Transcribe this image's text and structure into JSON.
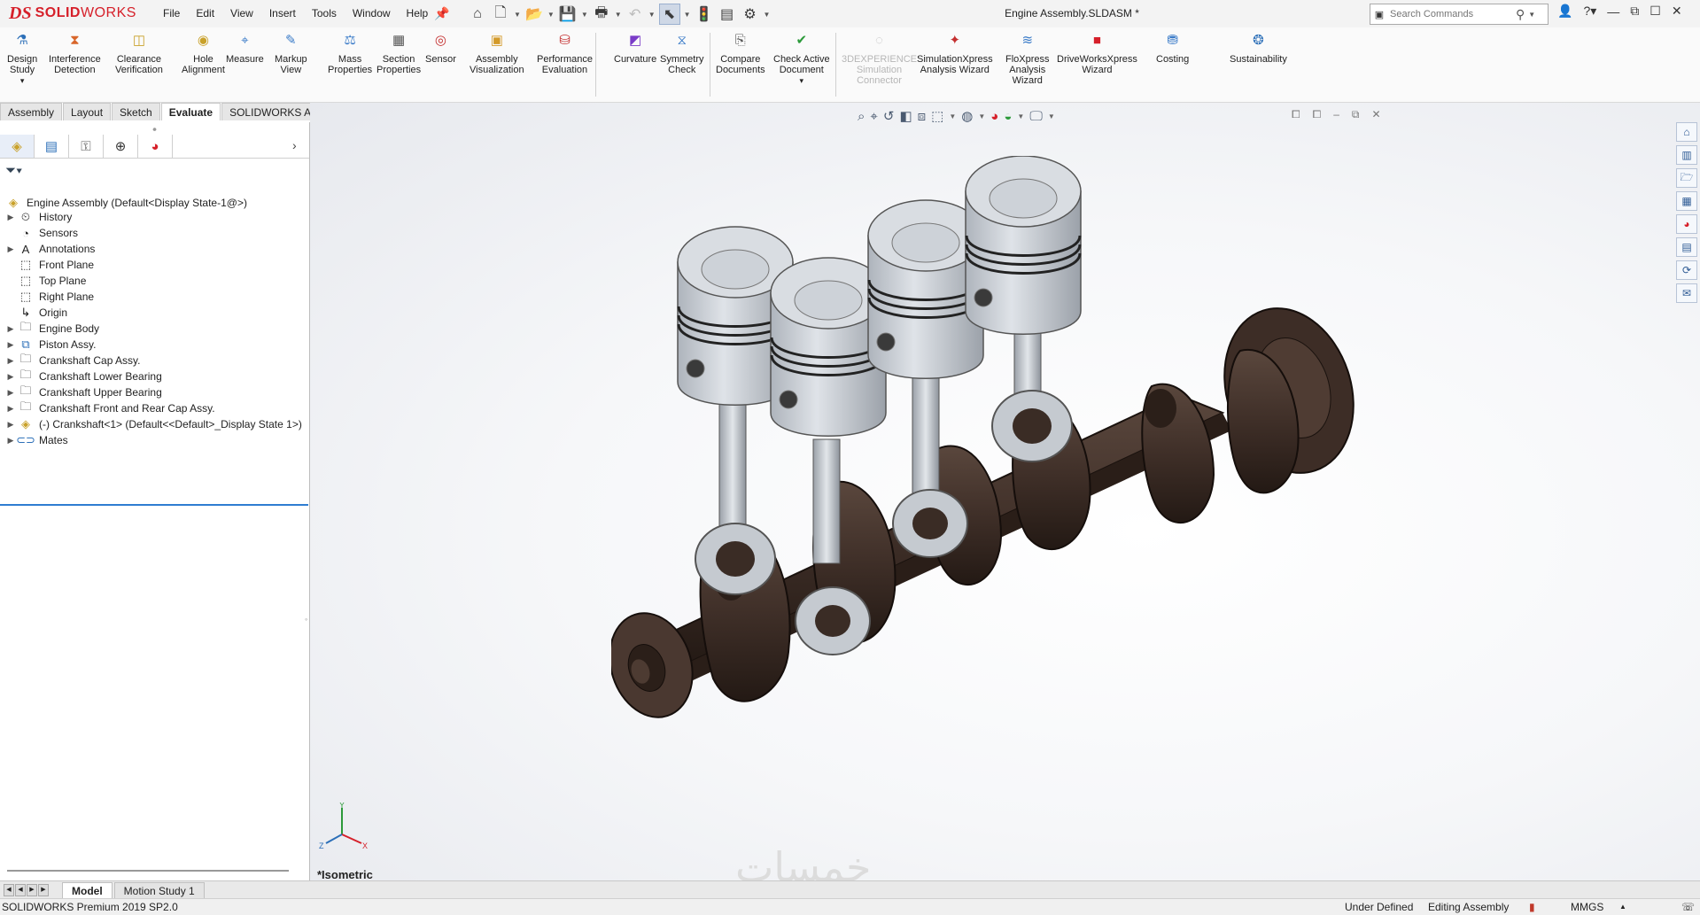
{
  "titlebar": {
    "brand_ds": "DS",
    "brand_name_bold": "SOLID",
    "brand_name_rest": "WORKS",
    "document_title": "Engine Assembly.SLDASM *",
    "menus": [
      "File",
      "Edit",
      "View",
      "Insert",
      "Tools",
      "Window",
      "Help"
    ],
    "search_placeholder": "Search Commands",
    "window_controls": [
      "user-icon",
      "help-icon",
      "minimize-icon",
      "restore-icon",
      "maximize-icon",
      "close-icon"
    ]
  },
  "quick_access": {
    "icons": [
      "home-icon",
      "new-document-icon",
      "open-icon",
      "save-icon",
      "print-icon",
      "undo-icon",
      "select-icon",
      "rebuild-icon",
      "file-properties-icon",
      "options-icon"
    ]
  },
  "commands": [
    {
      "label1": "Design",
      "label2": "Study",
      "icon": "design-study-icon",
      "color": "#2c6fb8"
    },
    {
      "label1": "Interference",
      "label2": "Detection",
      "icon": "interference-detection-icon",
      "color": "#d8662a"
    },
    {
      "label1": "Clearance",
      "label2": "Verification",
      "icon": "clearance-verification-icon",
      "color": "#c9a12a"
    },
    {
      "label1": "Hole",
      "label2": "Alignment",
      "icon": "hole-alignment-icon",
      "color": "#c9a12a"
    },
    {
      "label1": "Measure",
      "label2": "",
      "icon": "measure-icon",
      "color": "#3a7bc8"
    },
    {
      "label1": "Markup",
      "label2": "View",
      "icon": "markup-view-icon",
      "color": "#3a7bc8"
    },
    {
      "label1": "Mass",
      "label2": "Properties",
      "icon": "mass-properties-icon",
      "color": "#3a7bc8"
    },
    {
      "label1": "Section",
      "label2": "Properties",
      "icon": "section-properties-icon",
      "color": "#555555"
    },
    {
      "label1": "Sensor",
      "label2": "",
      "icon": "sensor-icon",
      "color": "#c43030"
    },
    {
      "label1": "Assembly",
      "label2": "Visualization",
      "icon": "assembly-visualization-icon",
      "color": "#d39a2a"
    },
    {
      "label1": "Performance",
      "label2": "Evaluation",
      "icon": "performance-evaluation-icon",
      "color": "#c43030"
    },
    {
      "label1": "Curvature",
      "label2": "",
      "icon": "curvature-icon",
      "color": "#7a3cc8"
    },
    {
      "label1": "Symmetry",
      "label2": "Check",
      "icon": "symmetry-check-icon",
      "color": "#3a7bc8"
    },
    {
      "label1": "Compare",
      "label2": "Documents",
      "icon": "compare-documents-icon",
      "color": "#555555"
    },
    {
      "label1": "Check Active",
      "label2": "Document",
      "icon": "check-active-document-icon",
      "color": "#2c9a3a"
    },
    {
      "label1": "3DEXPERIENCE",
      "label2": "Simulation",
      "label3": "Connector",
      "icon": "3dexperience-connector-icon",
      "color": "#bbbbbb",
      "disabled": true
    },
    {
      "label1": "SimulationXpress",
      "label2": "Analysis Wizard",
      "icon": "simulationxpress-icon",
      "color": "#c43030"
    },
    {
      "label1": "FloXpress",
      "label2": "Analysis",
      "label3": "Wizard",
      "icon": "floxpress-icon",
      "color": "#3a7bc8"
    },
    {
      "label1": "DriveWorksXpress",
      "label2": "Wizard",
      "icon": "driveworksxpress-icon",
      "color": "#d6202a"
    },
    {
      "label1": "Costing",
      "label2": "",
      "icon": "costing-icon",
      "color": "#3a7bc8"
    },
    {
      "label1": "Sustainability",
      "label2": "",
      "icon": "sustainability-icon",
      "color": "#2c6fb8"
    }
  ],
  "command_tabs": [
    "Assembly",
    "Layout",
    "Sketch",
    "Evaluate",
    "SOLIDWORKS Add-Ins"
  ],
  "active_command_tab": "Evaluate",
  "panel_tabs": [
    "featuremanager-icon",
    "propertymanager-icon",
    "configurationmanager-icon",
    "dimxpertmanager-icon",
    "displaymanager-icon"
  ],
  "tree": {
    "root": "Engine Assembly  (Default<Display State-1@>)",
    "items": [
      {
        "label": "History",
        "icon": "history-icon",
        "expandable": true
      },
      {
        "label": "Sensors",
        "icon": "sensors-icon",
        "expandable": false
      },
      {
        "label": "Annotations",
        "icon": "annotations-icon",
        "expandable": true
      },
      {
        "label": "Front Plane",
        "icon": "plane-icon",
        "expandable": false
      },
      {
        "label": "Top Plane",
        "icon": "plane-icon",
        "expandable": false
      },
      {
        "label": "Right Plane",
        "icon": "plane-icon",
        "expandable": false
      },
      {
        "label": "Origin",
        "icon": "origin-icon",
        "expandable": false
      },
      {
        "label": "Engine Body",
        "icon": "folder-icon",
        "expandable": true
      },
      {
        "label": "Piston Assy.",
        "icon": "subassembly-icon",
        "expandable": true
      },
      {
        "label": "Crankshaft Cap Assy.",
        "icon": "folder-icon",
        "expandable": true
      },
      {
        "label": "Crankshaft Lower Bearing",
        "icon": "folder-icon",
        "expandable": true
      },
      {
        "label": "Crankshaft Upper Bearing",
        "icon": "folder-icon",
        "expandable": true
      },
      {
        "label": "Crankshaft Front and Rear Cap Assy.",
        "icon": "folder-icon",
        "expandable": true
      },
      {
        "label": "(-) Crankshaft<1> (Default<<Default>_Display State 1>)",
        "icon": "part-icon",
        "expandable": true
      },
      {
        "label": "Mates",
        "icon": "mates-icon",
        "expandable": true
      }
    ]
  },
  "bottom_tabs": [
    "Model",
    "Motion Study 1"
  ],
  "active_bottom_tab": "Model",
  "viewport": {
    "view_name": "*Isometric",
    "watermark": "خمسات",
    "triad": {
      "x": "X",
      "y": "Y",
      "z": "Z"
    },
    "headsup_icons": [
      "zoom-to-fit-icon",
      "zoom-to-area-icon",
      "previous-view-icon",
      "section-view-icon",
      "dynamic-annotation-icon",
      "view-orientation-icon",
      "display-style-icon",
      "hide-show-items-icon",
      "edit-appearance-icon",
      "apply-scene-icon",
      "view-settings-icon"
    ],
    "taskpane_icons": [
      "home-pane-icon",
      "design-library-icon",
      "file-explorer-icon",
      "view-palette-icon",
      "appearances-icon",
      "custom-properties-icon",
      "resources-icon",
      "forum-icon"
    ]
  },
  "statusbar": {
    "product": "SOLIDWORKS Premium 2019 SP2.0",
    "under_defined": "Under Defined",
    "editing": "Editing Assembly",
    "units": "MMGS"
  },
  "colors": {
    "brand_red": "#d6202a",
    "crank_brown": "#3f2f28",
    "piston_gray": "#bfc4cb",
    "selection_blue": "#2f7dd1"
  }
}
